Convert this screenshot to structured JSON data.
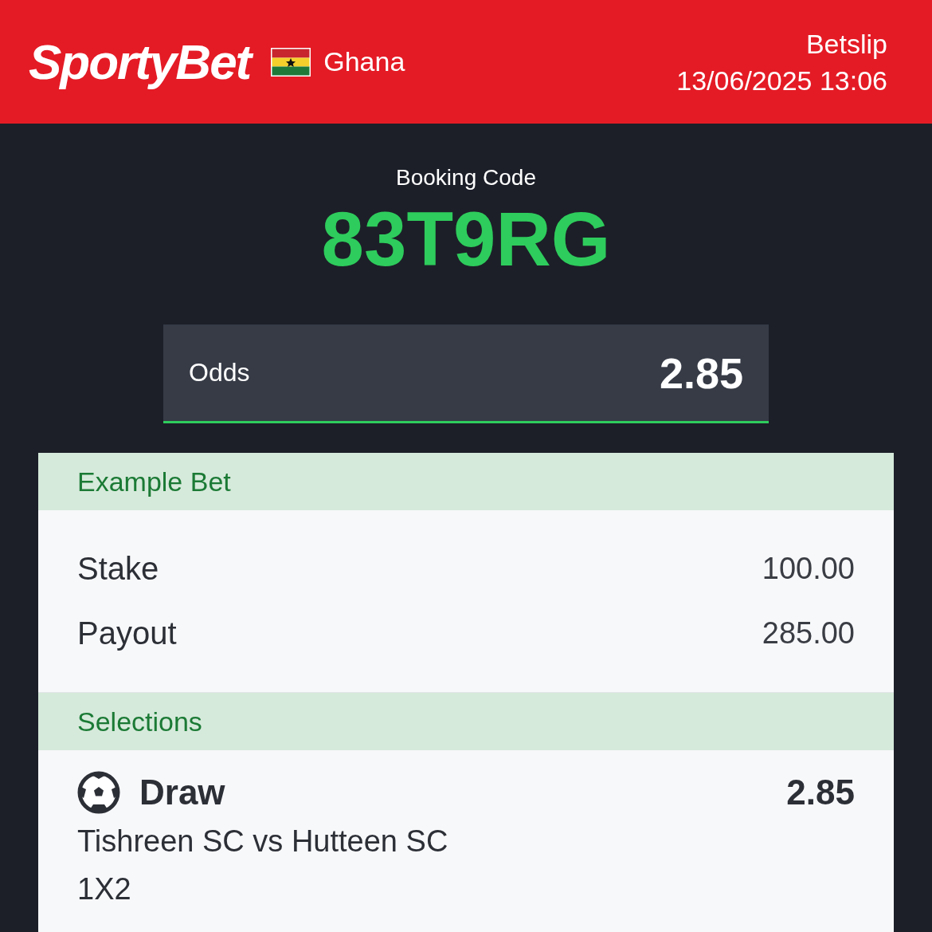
{
  "header": {
    "logo": "SportyBet",
    "country": "Ghana",
    "title": "Betslip",
    "datetime": "13/06/2025 13:06"
  },
  "booking": {
    "label": "Booking Code",
    "code": "83T9RG"
  },
  "odds": {
    "label": "Odds",
    "value": "2.85"
  },
  "example_bet": {
    "title": "Example Bet",
    "rows": [
      {
        "label": "Stake",
        "value": "100.00"
      },
      {
        "label": "Payout",
        "value": "285.00"
      }
    ]
  },
  "selections": {
    "title": "Selections",
    "items": [
      {
        "pick": "Draw",
        "odds": "2.85",
        "match": "Tishreen SC vs Hutteen SC",
        "market": "1X2"
      }
    ]
  }
}
